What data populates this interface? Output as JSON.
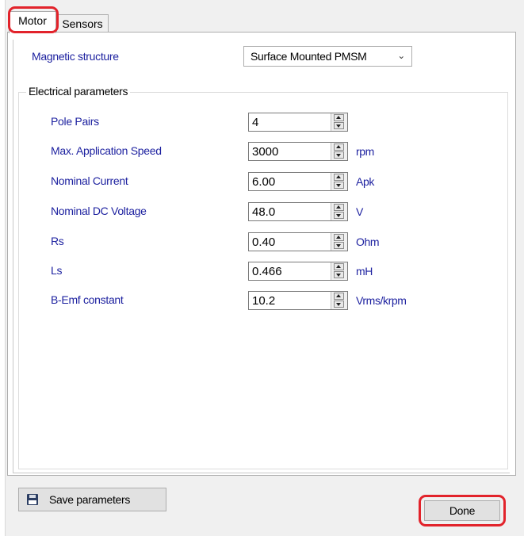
{
  "tabs": [
    {
      "label": "Motor"
    },
    {
      "label": "Sensors"
    }
  ],
  "magnetic_structure": {
    "label": "Magnetic structure",
    "value": "Surface Mounted PMSM"
  },
  "electrical": {
    "title": "Electrical parameters",
    "params": [
      {
        "label": "Pole Pairs",
        "value": "4",
        "unit": ""
      },
      {
        "label": "Max. Application Speed",
        "value": "3000",
        "unit": "rpm"
      },
      {
        "label": "Nominal Current",
        "value": "6.00",
        "unit": "Apk"
      },
      {
        "label": "Nominal DC Voltage",
        "value": "48.0",
        "unit": "V"
      },
      {
        "label": "Rs",
        "value": "0.40",
        "unit": "Ohm"
      },
      {
        "label": "Ls",
        "value": "0.466",
        "unit": "mH"
      },
      {
        "label": "B-Emf constant",
        "value": "10.2",
        "unit": "Vrms/krpm"
      }
    ]
  },
  "buttons": {
    "save": "Save parameters",
    "done": "Done"
  },
  "colors": {
    "highlight": "#e2232b",
    "label_blue": "#1e22a0"
  }
}
